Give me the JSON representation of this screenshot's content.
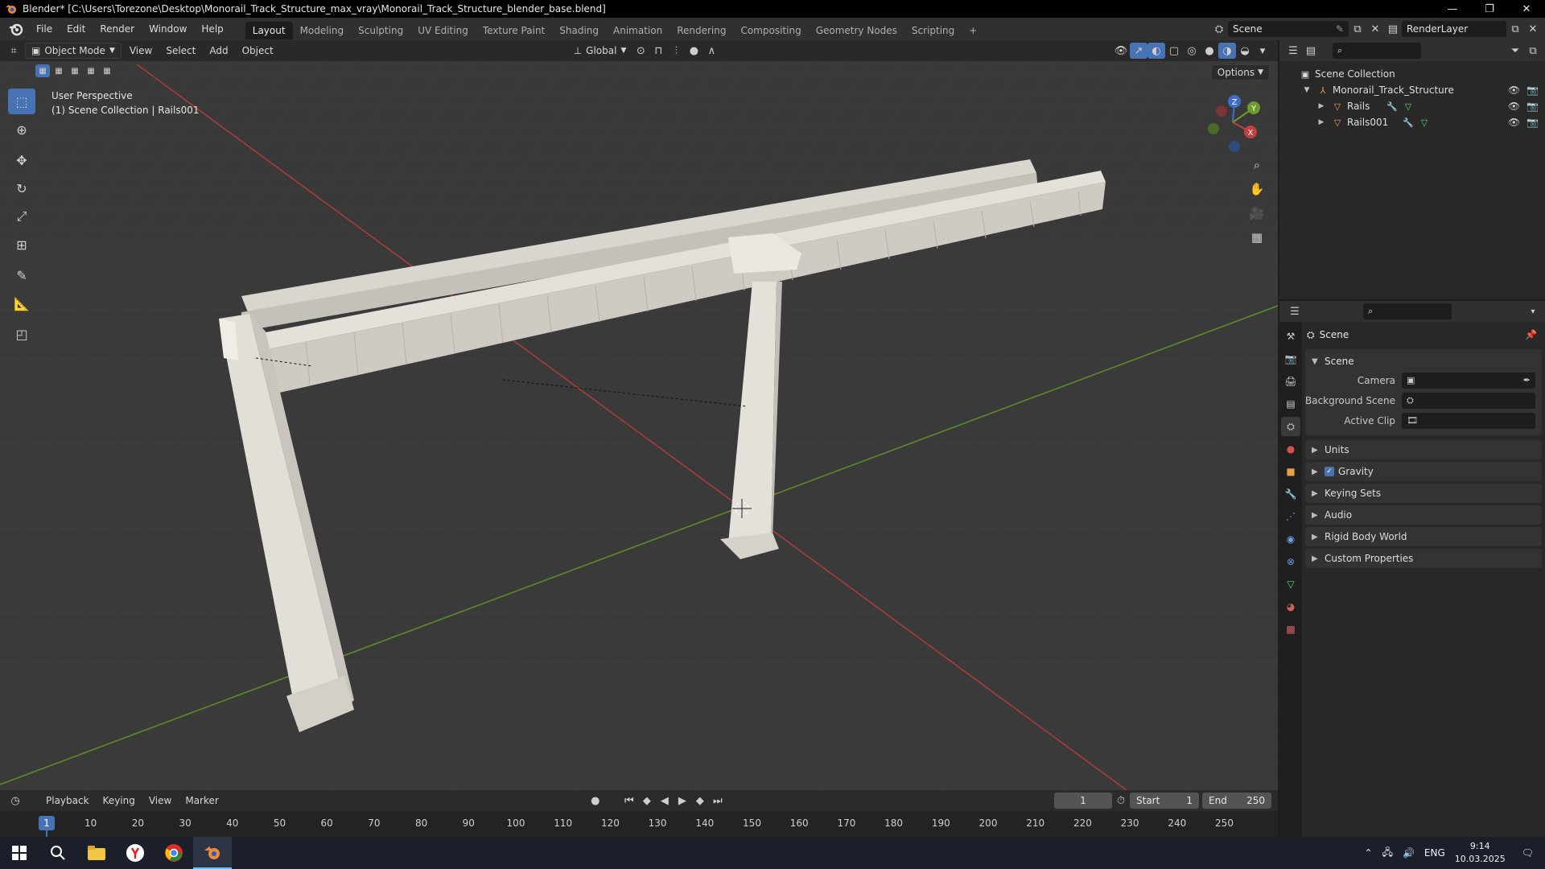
{
  "window": {
    "title": "Blender* [C:\\Users\\Torezone\\Desktop\\Monorail_Track_Structure_max_vray\\Monorail_Track_Structure_blender_base.blend]",
    "minimize": "—",
    "maximize": "❐",
    "close": "✕"
  },
  "menu": [
    "File",
    "Edit",
    "Render",
    "Window",
    "Help"
  ],
  "workspaces": [
    "Layout",
    "Modeling",
    "Sculpting",
    "UV Editing",
    "Texture Paint",
    "Shading",
    "Animation",
    "Rendering",
    "Compositing",
    "Geometry Nodes",
    "Scripting"
  ],
  "workspace_add": "+",
  "scene": {
    "name": "Scene",
    "render_layer": "RenderLayer"
  },
  "viewport": {
    "mode": "Object Mode",
    "menus": [
      "View",
      "Select",
      "Add",
      "Object"
    ],
    "transform_orientation": "Global",
    "options_label": "Options",
    "info_line1": "User Perspective",
    "info_line2": "(1) Scene Collection | Rails001",
    "gizmo": {
      "x": "X",
      "y": "Y",
      "z": "Z"
    }
  },
  "outliner": {
    "root": "Scene Collection",
    "collection": "Monorail_Track_Structure",
    "objects": [
      "Rails",
      "Rails001"
    ]
  },
  "properties": {
    "context_title": "Scene",
    "panel_title": "Scene",
    "rows": [
      {
        "label": "Camera",
        "value": ""
      },
      {
        "label": "Background Scene",
        "value": ""
      },
      {
        "label": "Active Clip",
        "value": ""
      }
    ],
    "sub_panels": [
      "Units",
      "Gravity",
      "Keying Sets",
      "Audio",
      "Rigid Body World",
      "Custom Properties"
    ],
    "gravity_checked": true
  },
  "timeline": {
    "menus": [
      "Playback",
      "Keying",
      "View",
      "Marker"
    ],
    "current_frame": "1",
    "start_label": "Start",
    "start_value": "1",
    "end_label": "End",
    "end_value": "250",
    "ticks": [
      "1",
      "10",
      "20",
      "30",
      "40",
      "50",
      "60",
      "70",
      "80",
      "90",
      "100",
      "110",
      "120",
      "130",
      "140",
      "150",
      "160",
      "170",
      "180",
      "190",
      "200",
      "210",
      "220",
      "230",
      "240",
      "250"
    ]
  },
  "taskbar": {
    "language": "ENG",
    "time": "9:14",
    "date": "10.03.2025"
  },
  "colors": {
    "accent": "#4772b3",
    "x_axis": "#c24042",
    "y_axis": "#6e9a2b",
    "z_axis": "#3d6fc9"
  }
}
